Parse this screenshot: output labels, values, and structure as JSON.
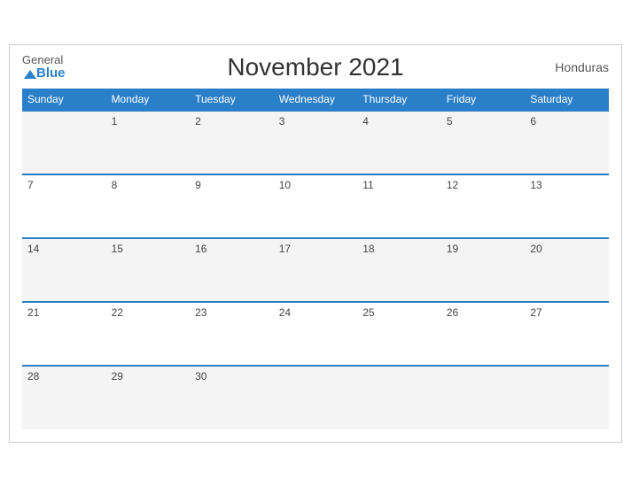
{
  "header": {
    "logo_general": "General",
    "logo_blue": "Blue",
    "title": "November 2021",
    "country": "Honduras"
  },
  "weekdays": [
    "Sunday",
    "Monday",
    "Tuesday",
    "Wednesday",
    "Thursday",
    "Friday",
    "Saturday"
  ],
  "weeks": [
    [
      "",
      "1",
      "2",
      "3",
      "4",
      "5",
      "6"
    ],
    [
      "7",
      "8",
      "9",
      "10",
      "11",
      "12",
      "13"
    ],
    [
      "14",
      "15",
      "16",
      "17",
      "18",
      "19",
      "20"
    ],
    [
      "21",
      "22",
      "23",
      "24",
      "25",
      "26",
      "27"
    ],
    [
      "28",
      "29",
      "30",
      "",
      "",
      "",
      ""
    ]
  ]
}
